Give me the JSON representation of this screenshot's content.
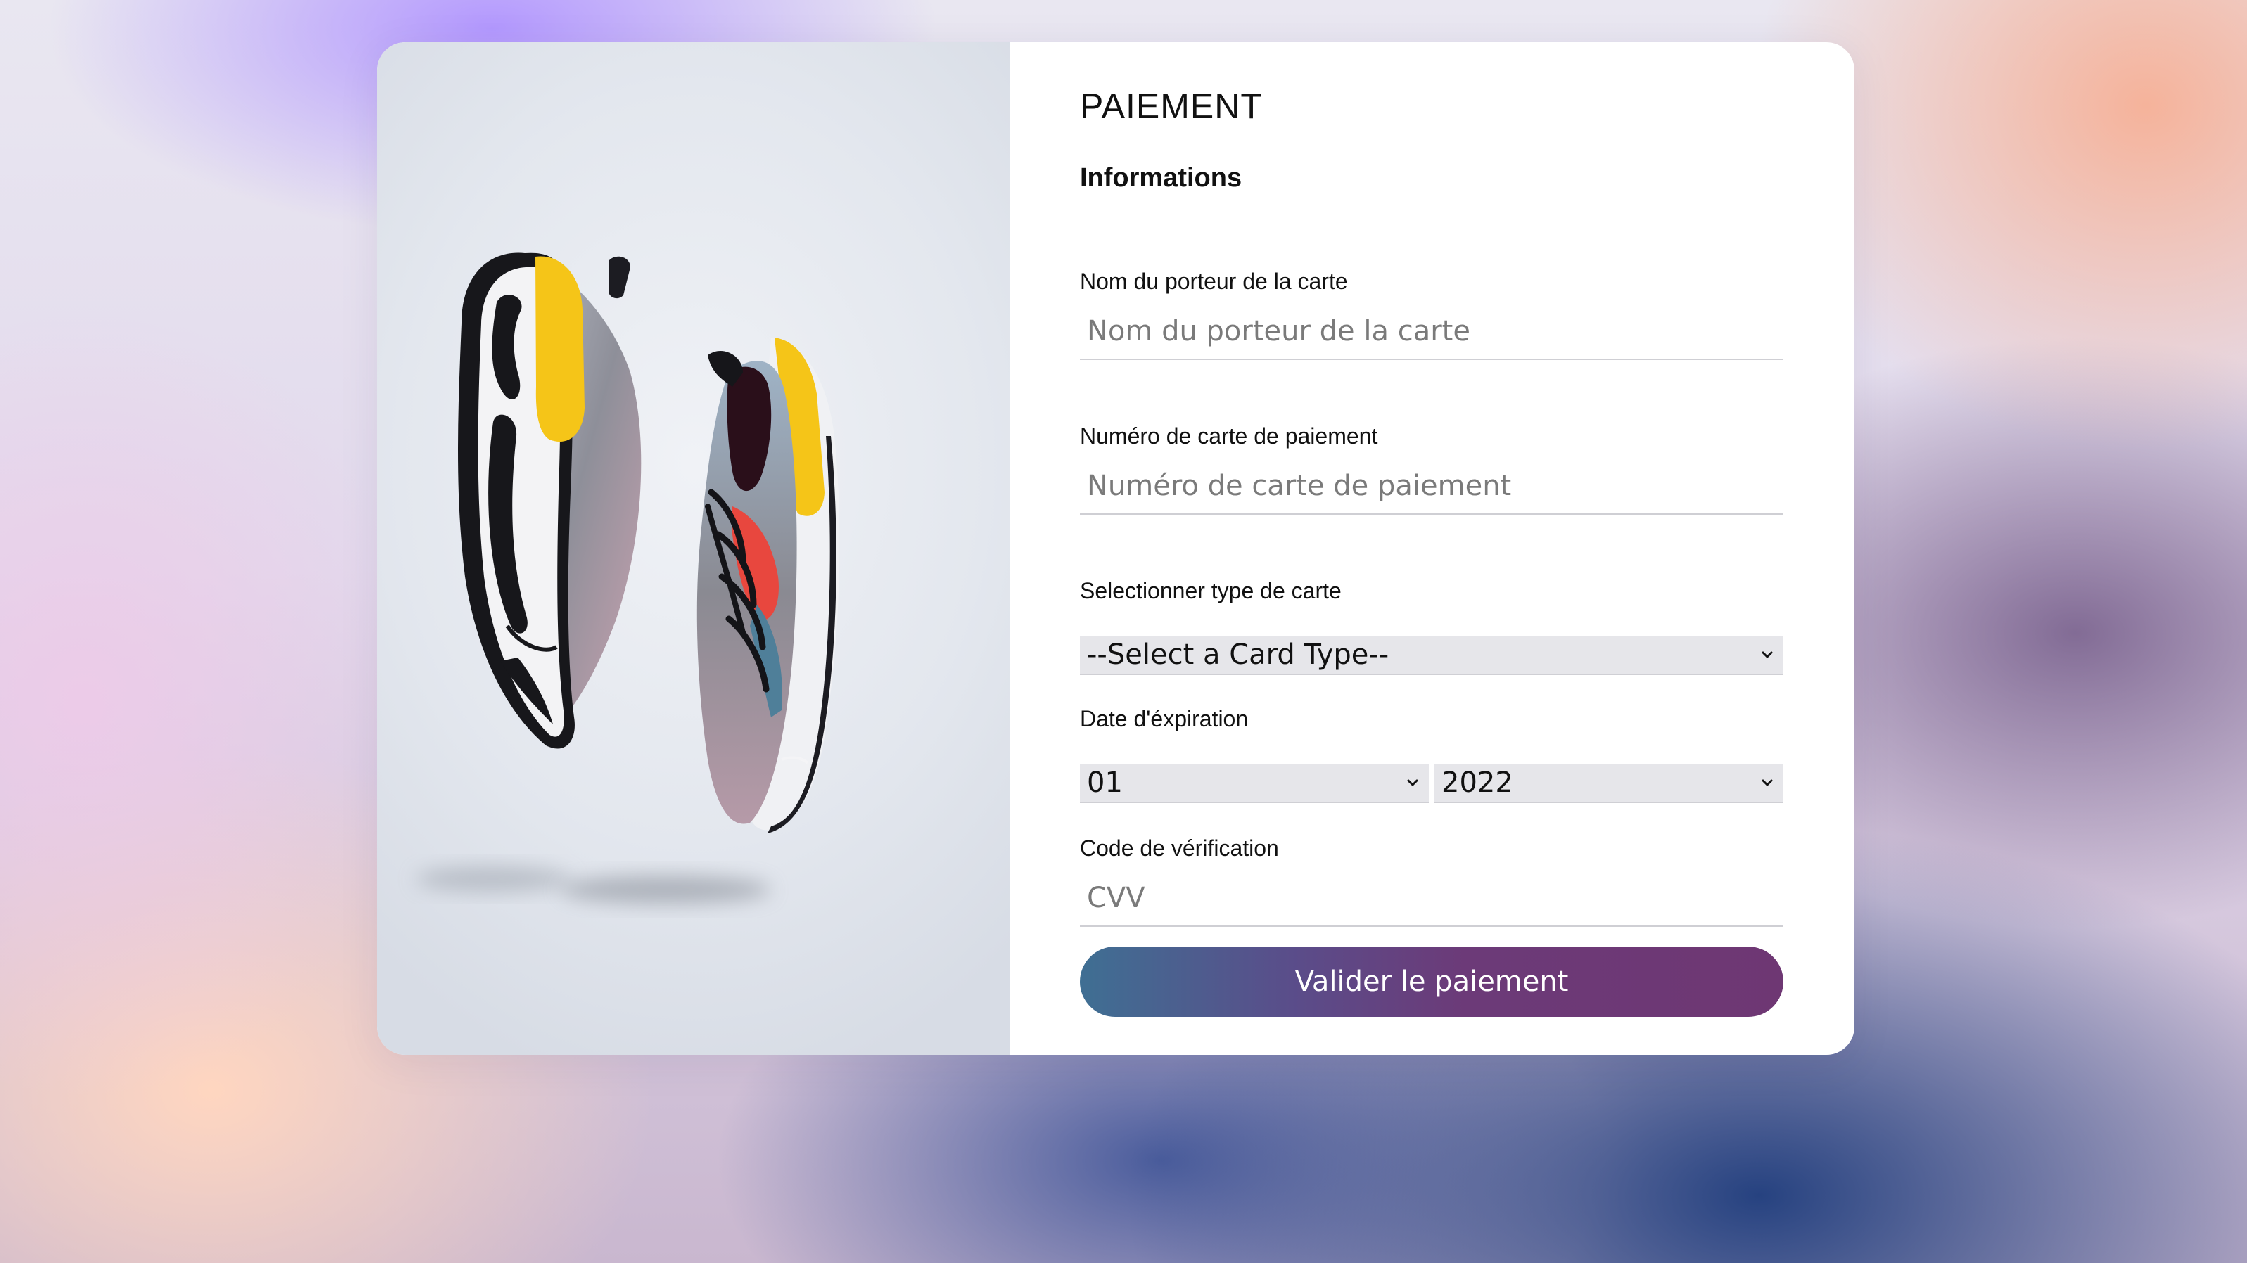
{
  "form": {
    "title": "PAIEMENT",
    "section_title": "Informations",
    "cardholder": {
      "label": "Nom du porteur de la carte",
      "placeholder": "Nom du porteur de la carte",
      "value": ""
    },
    "card_number": {
      "label": "Numéro de carte de paiement",
      "placeholder": "Numéro de carte de paiement",
      "value": ""
    },
    "card_type": {
      "label": "Selectionner type de carte",
      "selected": "--Select a Card Type--"
    },
    "expiration": {
      "label": "Date d'éxpiration",
      "month_selected": "01",
      "year_selected": "2022"
    },
    "cvv": {
      "label": "Code de vérification",
      "placeholder": "CVV",
      "value": ""
    },
    "submit_label": "Valider le paiement"
  },
  "image": {
    "subject": "pair of sneakers floating (product photo)"
  },
  "colors": {
    "button_gradient_start": "#3f6f93",
    "button_gradient_end": "#6e3773",
    "shoe_accent_yellow": "#f5c518",
    "shoe_accent_red": "#e8473e"
  },
  "icons": {
    "select_arrow": "chevron-down-icon"
  }
}
